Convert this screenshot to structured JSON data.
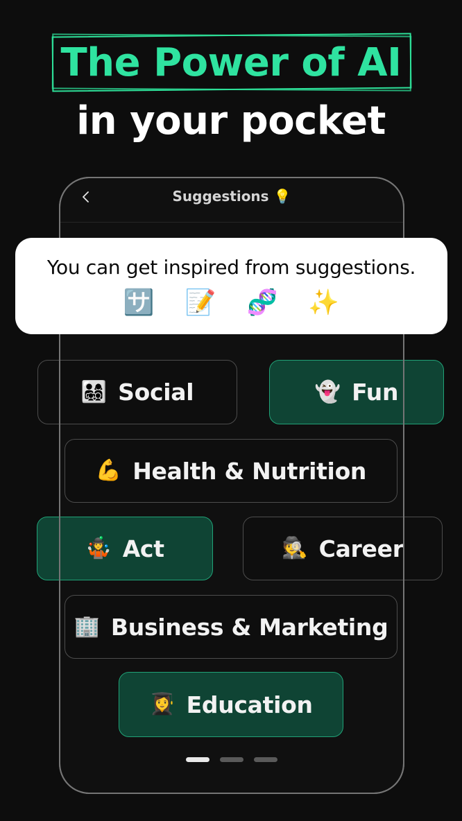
{
  "headline": {
    "line1": "The Power of AI",
    "line2": "in your pocket",
    "accent_color": "#2ee29a",
    "text_color": "#ffffff"
  },
  "phone": {
    "header": {
      "back_icon": "chevron-left-icon",
      "title": "Suggestions 💡"
    },
    "tooltip": {
      "text": "You can get inspired from suggestions.",
      "emojis": [
        {
          "name": "translate-emoji",
          "glyph": "🈂️"
        },
        {
          "name": "memo-emoji",
          "glyph": "📝"
        },
        {
          "name": "dna-emoji",
          "glyph": "🧬"
        },
        {
          "name": "sparkles-emoji",
          "glyph": "✨"
        }
      ]
    },
    "categories": [
      {
        "id": "social",
        "emoji": "👨‍👩‍👧‍👦",
        "emoji_name": "family-emoji",
        "label": "Social",
        "selected": false
      },
      {
        "id": "fun",
        "emoji": "👻",
        "emoji_name": "ghost-emoji",
        "label": "Fun",
        "selected": true
      },
      {
        "id": "health",
        "emoji": "💪",
        "emoji_name": "flexed-biceps-emoji",
        "label": "Health & Nutrition",
        "selected": false
      },
      {
        "id": "act",
        "emoji": "🤹",
        "emoji_name": "juggling-emoji",
        "label": "Act",
        "selected": true
      },
      {
        "id": "career",
        "emoji": "🕵️",
        "emoji_name": "detective-emoji",
        "label": "Career",
        "selected": false
      },
      {
        "id": "business",
        "emoji": "🏢",
        "emoji_name": "office-building-emoji",
        "label": "Business & Marketing",
        "selected": false
      },
      {
        "id": "education",
        "emoji": "👩‍🎓",
        "emoji_name": "graduate-emoji",
        "label": "Education",
        "selected": true
      }
    ],
    "pagination": {
      "total": 3,
      "active_index": 1
    }
  },
  "colors": {
    "background": "#0d0d0d",
    "selected_fill": "#0f4434",
    "selected_border": "#21a277",
    "unselected_border": "#4d4d4d",
    "frame": "#757575",
    "card": "#ffffff"
  }
}
